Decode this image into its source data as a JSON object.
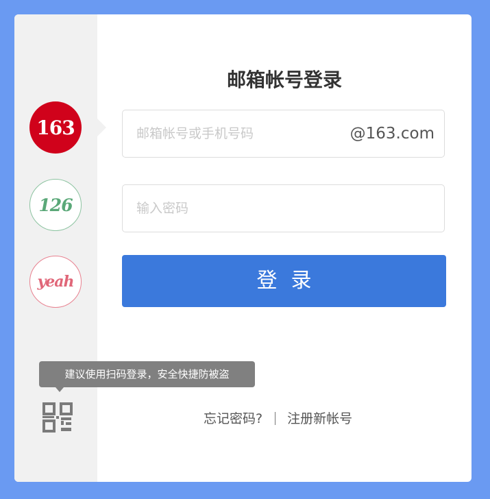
{
  "login": {
    "title": "邮箱帐号登录",
    "brands": [
      {
        "label": "163",
        "color": "#d0021b",
        "selected": true
      },
      {
        "label": "126",
        "color": "#5aa878",
        "selected": false
      },
      {
        "label": "yeah",
        "color": "#e06678",
        "selected": false
      }
    ],
    "username_placeholder": "邮箱帐号或手机号码",
    "username_value": "",
    "domain_suffix": "@163.com",
    "password_placeholder": "输入密码",
    "password_value": "",
    "submit_label": "登录",
    "forgot_label": "忘记密码?",
    "register_label": "注册新帐号",
    "qr_tooltip": "建议使用扫码登录，安全快捷防被盗",
    "qr_icon": "qr-code-icon"
  },
  "colors": {
    "page_background": "#6a9af2",
    "primary_button": "#3b79dc",
    "sidebar": "#f1f1f1"
  }
}
